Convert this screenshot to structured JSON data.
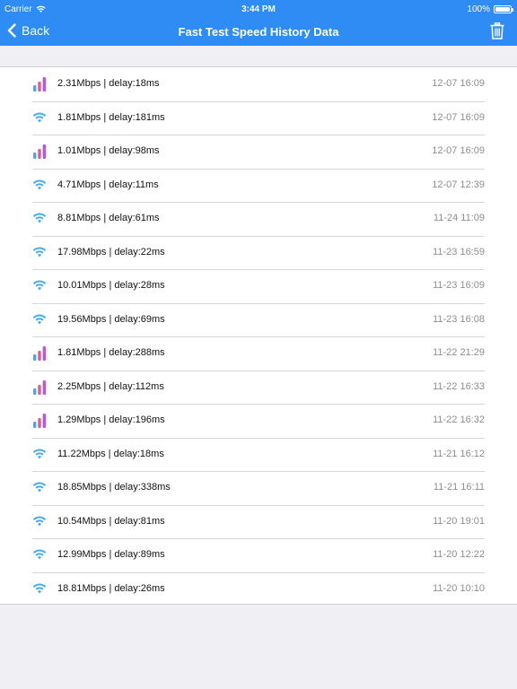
{
  "status_bar": {
    "carrier": "Carrier",
    "time": "3:44 PM",
    "battery": "100%"
  },
  "nav": {
    "back_label": "Back",
    "title": "Fast Test Speed History Data"
  },
  "colors": {
    "nav_bg": "#2f8cf5",
    "wifi_icon": "#3fa9f5",
    "cell_icon_bar1": "#3fa9f5",
    "cell_icon_bar2": "#e05c8a",
    "cell_icon_bar3": "#b45cd6"
  },
  "rows": [
    {
      "icon": "cellular-icon",
      "text": "2.31Mbps | delay:18ms",
      "time": "12-07 16:09"
    },
    {
      "icon": "wifi-icon",
      "text": "1.81Mbps | delay:181ms",
      "time": "12-07 16:09"
    },
    {
      "icon": "cellular-icon",
      "text": "1.01Mbps | delay:98ms",
      "time": "12-07 16:09"
    },
    {
      "icon": "wifi-icon",
      "text": "4.71Mbps | delay:11ms",
      "time": "12-07 12:39"
    },
    {
      "icon": "wifi-icon",
      "text": "8.81Mbps | delay:61ms",
      "time": "11-24 11:09"
    },
    {
      "icon": "wifi-icon",
      "text": "17.98Mbps | delay:22ms",
      "time": "11-23 16:59"
    },
    {
      "icon": "wifi-icon",
      "text": "10.01Mbps | delay:28ms",
      "time": "11-23 16:09"
    },
    {
      "icon": "wifi-icon",
      "text": "19.56Mbps | delay:69ms",
      "time": "11-23 16:08"
    },
    {
      "icon": "cellular-icon",
      "text": "1.81Mbps | delay:288ms",
      "time": "11-22 21:29"
    },
    {
      "icon": "cellular-icon",
      "text": "2.25Mbps | delay:112ms",
      "time": "11-22 16:33"
    },
    {
      "icon": "cellular-icon",
      "text": "1.29Mbps | delay:196ms",
      "time": "11-22 16:32"
    },
    {
      "icon": "wifi-icon",
      "text": "11.22Mbps | delay:18ms",
      "time": "11-21 16:12"
    },
    {
      "icon": "wifi-icon",
      "text": "18.85Mbps | delay:338ms",
      "time": "11-21 16:11"
    },
    {
      "icon": "wifi-icon",
      "text": "10.54Mbps | delay:81ms",
      "time": "11-20 19:01"
    },
    {
      "icon": "wifi-icon",
      "text": "12.99Mbps | delay:89ms",
      "time": "11-20 12:22"
    },
    {
      "icon": "wifi-icon",
      "text": "18.81Mbps | delay:26ms",
      "time": "11-20 10:10"
    }
  ]
}
